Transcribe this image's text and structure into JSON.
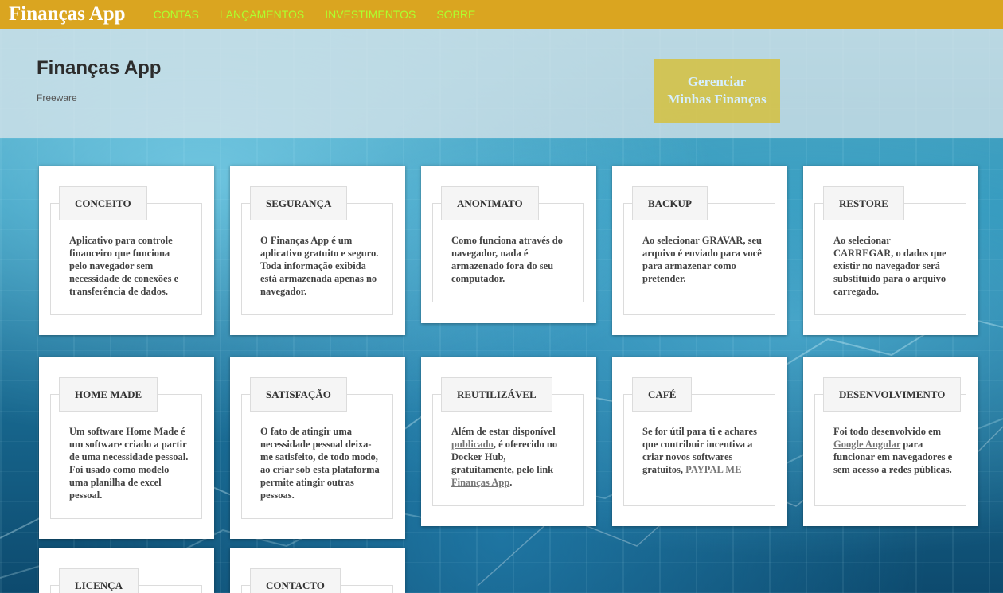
{
  "navbar": {
    "brand": "Finanças App",
    "links": [
      "CONTAS",
      "LANÇAMENTOS",
      "INVESTIMENTOS",
      "SOBRE"
    ]
  },
  "hero": {
    "title": "Finanças App",
    "subtitle": "Freeware",
    "button_line1": "Gerenciar",
    "button_line2": "Minhas Finanças"
  },
  "cards": {
    "conceito": {
      "title": "CONCEITO",
      "text": "Aplicativo para controle financeiro que funciona pelo navegador sem necessidade de conexões e transferência de dados."
    },
    "seguranca": {
      "title": "SEGURANÇA",
      "text": "O Finanças App é um aplicativo gratuito e seguro. Toda informação exibida está armazenada apenas no navegador."
    },
    "anonimato": {
      "title": "ANONIMATO",
      "text": "Como funciona através do navegador, nada é armazenado fora do seu computador."
    },
    "backup": {
      "title": "BACKUP",
      "text": "Ao selecionar GRAVAR, seu arquivo é enviado para você para armazenar como pretender."
    },
    "restore": {
      "title": "RESTORE",
      "text": "Ao selecionar CARREGAR, o dados que existir no navegador será substituído para o arquivo carregado."
    },
    "homemade": {
      "title": "HOME MADE",
      "text": "Um software Home Made é um software criado a partir de uma necessidade pessoal. Foi usado como modelo uma planilha de excel pessoal."
    },
    "satisfacao": {
      "title": "SATISFAÇÃO",
      "text": "O fato de atingir uma necessidade pessoal deixa-me satisfeito, de todo modo, ao criar sob esta plataforma permite atingir outras pessoas."
    },
    "reutilizavel": {
      "title": "REUTILIZÁVEL",
      "text_1": "Além de estar disponível",
      "link_1": "publicado",
      "text_2": ", é oferecido no Docker Hub, gratuitamente, pelo link",
      "link_2": "Finanças App",
      "text_3": "."
    },
    "cafe": {
      "title": "CAFÉ",
      "text_1": "Se for útil para ti e achares que contribuir incentiva a criar novos softwares gratuitos,",
      "link_1": "PAYPAL ME"
    },
    "desenvolvimento": {
      "title": "DESENVOLVIMENTO",
      "text_1": "Foi todo desenvolvido em",
      "link_1": "Google Angular",
      "text_2": "para funcionar em navegadores e sem acesso a redes públicas."
    },
    "licenca": {
      "title": "LICENÇA"
    },
    "contacto": {
      "title": "CONTACTO"
    }
  },
  "colors": {
    "navbar_bg": "#daa520",
    "nav_link": "#adff2f",
    "brand_text": "#ffffff"
  }
}
